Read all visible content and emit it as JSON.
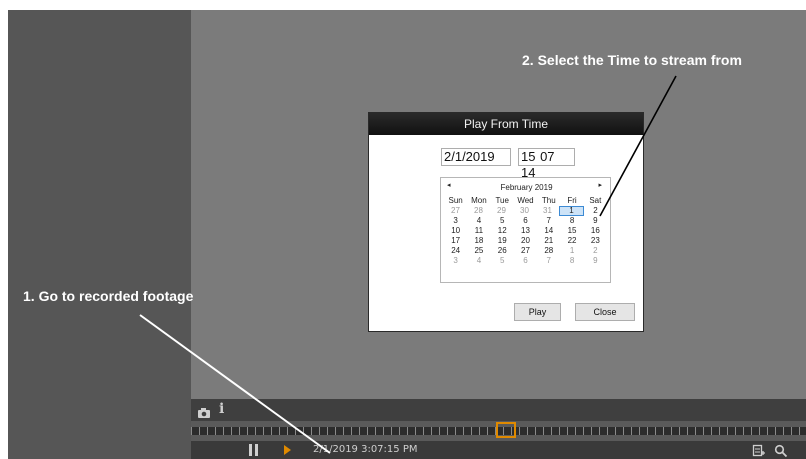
{
  "annotations": {
    "step1": "1. Go to recorded footage",
    "step2": "2. Select the Time to stream from"
  },
  "dialog": {
    "title": "Play From Time",
    "date_value": "2/1/2019",
    "time_value": "15 07 14",
    "buttons": {
      "play": "Play",
      "close": "Close"
    }
  },
  "calendar": {
    "month_label": "February 2019",
    "prev_glyph": "◂",
    "next_glyph": "▸",
    "weekdays": [
      "Sun",
      "Mon",
      "Tue",
      "Wed",
      "Thu",
      "Fri",
      "Sat"
    ],
    "selected_day": "1",
    "weeks": [
      [
        {
          "d": "27",
          "other": true
        },
        {
          "d": "28",
          "other": true
        },
        {
          "d": "29",
          "other": true
        },
        {
          "d": "30",
          "other": true
        },
        {
          "d": "31",
          "other": true
        },
        {
          "d": "1",
          "other": false
        },
        {
          "d": "2",
          "other": false
        }
      ],
      [
        {
          "d": "3",
          "other": false
        },
        {
          "d": "4",
          "other": false
        },
        {
          "d": "5",
          "other": false
        },
        {
          "d": "6",
          "other": false
        },
        {
          "d": "7",
          "other": false
        },
        {
          "d": "8",
          "other": false
        },
        {
          "d": "9",
          "other": false
        }
      ],
      [
        {
          "d": "10",
          "other": false
        },
        {
          "d": "11",
          "other": false
        },
        {
          "d": "12",
          "other": false
        },
        {
          "d": "13",
          "other": false
        },
        {
          "d": "14",
          "other": false
        },
        {
          "d": "15",
          "other": false
        },
        {
          "d": "16",
          "other": false
        }
      ],
      [
        {
          "d": "17",
          "other": false
        },
        {
          "d": "18",
          "other": false
        },
        {
          "d": "19",
          "other": false
        },
        {
          "d": "20",
          "other": false
        },
        {
          "d": "21",
          "other": false
        },
        {
          "d": "22",
          "other": false
        },
        {
          "d": "23",
          "other": false
        }
      ],
      [
        {
          "d": "24",
          "other": false
        },
        {
          "d": "25",
          "other": false
        },
        {
          "d": "26",
          "other": false
        },
        {
          "d": "27",
          "other": false
        },
        {
          "d": "28",
          "other": false
        },
        {
          "d": "1",
          "other": true
        },
        {
          "d": "2",
          "other": true
        }
      ],
      [
        {
          "d": "3",
          "other": true
        },
        {
          "d": "4",
          "other": true
        },
        {
          "d": "5",
          "other": true
        },
        {
          "d": "6",
          "other": true
        },
        {
          "d": "7",
          "other": true
        },
        {
          "d": "8",
          "other": true
        },
        {
          "d": "9",
          "other": true
        }
      ]
    ]
  },
  "playback": {
    "timestamp": "2/1/2019 3:07:15 PM",
    "info_glyph": "i"
  },
  "icons": {
    "snapshot": "camera-icon",
    "info": "info-icon",
    "pause": "pause-icon",
    "play": "play-icon",
    "export": "export-icon",
    "zoom": "zoom-icon"
  },
  "colors": {
    "accent": "#e08a00",
    "dialog_title_bg": "#1c1c1c",
    "selected_day_bg": "#cde3f7",
    "selected_day_border": "#3c8ad4",
    "annotation_text": "#ffffff",
    "arrow_line": "#000000"
  }
}
